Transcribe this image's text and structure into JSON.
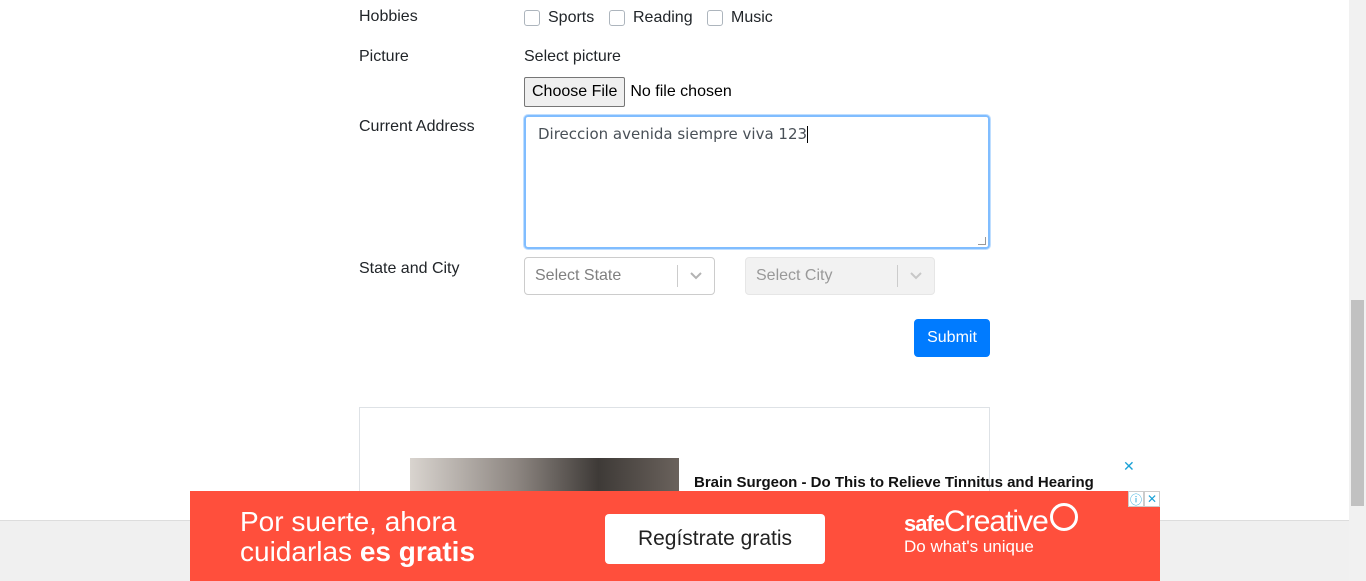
{
  "form": {
    "hobbies_label": "Hobbies",
    "hobbies": [
      {
        "label": "Sports",
        "checked": false
      },
      {
        "label": "Reading",
        "checked": false
      },
      {
        "label": "Music",
        "checked": false
      }
    ],
    "picture_label": "Picture",
    "select_picture_text": "Select picture",
    "choose_file_label": "Choose File",
    "no_file_text": "No file chosen",
    "address_label": "Current Address",
    "address_value": "Direccion avenida siempre viva 123",
    "state_city_label": "State and City",
    "state_placeholder": "Select State",
    "city_placeholder": "Select City",
    "submit_label": "Submit"
  },
  "ad": {
    "headline": "Brain Surgeon - Do This to Relieve Tinnitus and Hearing",
    "close_icon": "close-icon"
  },
  "banner": {
    "line1": "Por suerte, ahora",
    "line2_normal": "cuidarlas ",
    "line2_bold": "es gratis",
    "cta": "Regístrate gratis",
    "brand_prefix": "safe",
    "brand_main": "Creative",
    "tagline": "Do what's unique",
    "info_icon": "info-icon",
    "close_icon": "close-icon",
    "bg_color": "#ff4f3c"
  },
  "colors": {
    "primary": "#007bff",
    "focus_border": "#80bdff"
  }
}
